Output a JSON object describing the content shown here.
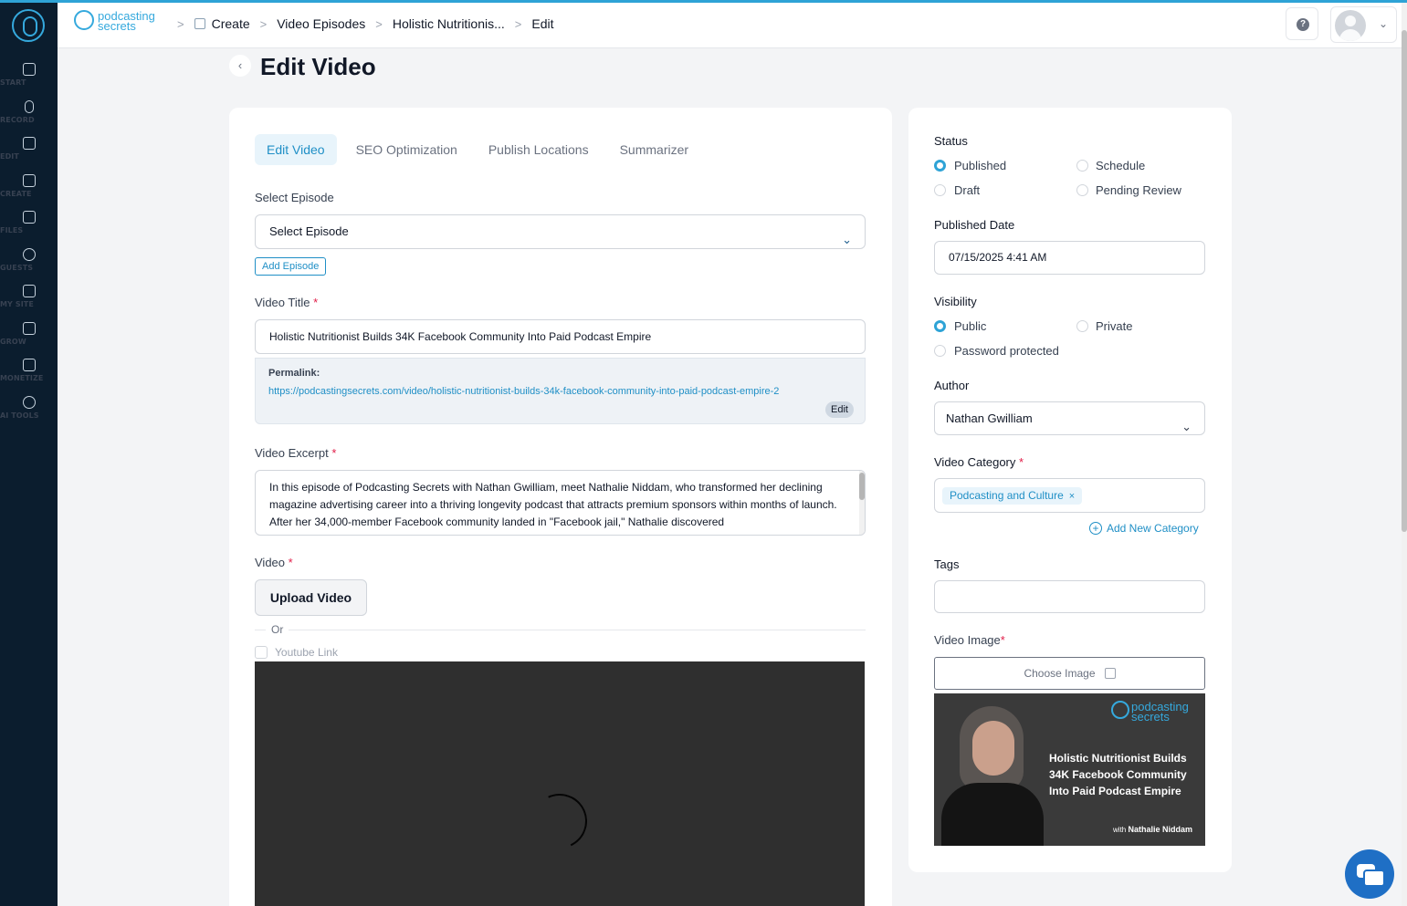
{
  "sidebar": {
    "items": [
      {
        "label": "START",
        "icon": "start-icon"
      },
      {
        "label": "RECORD",
        "icon": "microphone-icon"
      },
      {
        "label": "EDIT",
        "icon": "edit-icon"
      },
      {
        "label": "CREATE",
        "icon": "create-icon"
      },
      {
        "label": "FILES",
        "icon": "files-icon"
      },
      {
        "label": "GUESTS",
        "icon": "guests-icon"
      },
      {
        "label": "MY SITE",
        "icon": "site-icon"
      },
      {
        "label": "GROW",
        "icon": "grow-icon"
      },
      {
        "label": "MONETIZE",
        "icon": "monetize-icon"
      },
      {
        "label": "AI TOOLS",
        "icon": "ai-tools-icon"
      }
    ]
  },
  "header": {
    "brand_line1": "podcasting",
    "brand_line2": "secrets",
    "breadcrumbs": [
      "Create",
      "Video Episodes",
      "Holistic Nutritionis...",
      "Edit"
    ],
    "help_label": "?",
    "accent_color": "#2ea3d6"
  },
  "page": {
    "back_label": "‹",
    "title": "Edit Video"
  },
  "tabs": [
    "Edit Video",
    "SEO Optimization",
    "Publish Locations",
    "Summarizer"
  ],
  "form": {
    "select_episode_label": "Select Episode",
    "select_episode_value": "Select Episode",
    "add_episode_label": "Add Episode",
    "video_title_label": "Video Title",
    "required_mark": "*",
    "video_title_value": "Holistic Nutritionist Builds 34K Facebook Community Into Paid Podcast Empire",
    "permalink_label": "Permalink:",
    "permalink_url": "https://podcastingsecrets.com/video/holistic-nutritionist-builds-34k-facebook-community-into-paid-podcast-empire-2",
    "permalink_edit": "Edit",
    "video_excerpt_label": "Video Excerpt",
    "video_excerpt_value": "In this episode of Podcasting Secrets with Nathan Gwilliam, meet Nathalie Niddam, who transformed her declining magazine advertising career into a thriving longevity podcast that attracts premium sponsors within months of launch. After her 34,000-member Facebook community landed in \"Facebook jail,\" Nathalie discovered",
    "video_label": "Video",
    "upload_video_label": "Upload Video",
    "or_label": "Or",
    "youtube_link_label": "Youtube Link"
  },
  "side": {
    "status_label": "Status",
    "status_options": [
      "Published",
      "Schedule",
      "Draft",
      "Pending Review"
    ],
    "status_selected": "Published",
    "published_date_label": "Published Date",
    "published_date_value": "07/15/2025 4:41 AM",
    "visibility_label": "Visibility",
    "visibility_options": [
      "Public",
      "Private",
      "Password protected"
    ],
    "visibility_selected": "Public",
    "author_label": "Author",
    "author_value": "Nathan Gwilliam",
    "video_category_label": "Video Category",
    "category_tag": "Podcasting and Culture",
    "category_remove": "×",
    "add_category_label": "Add New Category",
    "tags_label": "Tags",
    "tags_value": "",
    "video_image_label": "Video Image",
    "choose_image_label": "Choose Image",
    "thumbnail": {
      "brand_line1": "podcasting",
      "brand_line2": "secrets",
      "title": "Holistic Nutritionist Builds 34K Facebook Community Into Paid Podcast Empire",
      "with_prefix": "with",
      "guest_name": "Nathalie Niddam"
    }
  }
}
